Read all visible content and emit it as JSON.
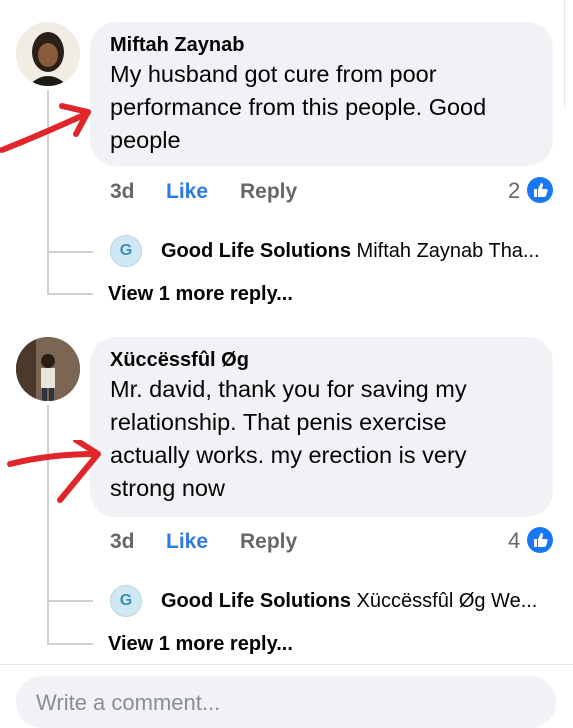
{
  "comments": [
    {
      "author": "Miftah Zaynab",
      "text_lines": [
        "My husband got cure from poor",
        "performance from this people. Good",
        "people"
      ],
      "time": "3d",
      "like_label": "Like",
      "reply_label": "Reply",
      "reaction_count": "2",
      "reply_preview": {
        "avatar_letter": "G",
        "name": "Good Life Solutions",
        "snippet": "Miftah Zaynab Tha..."
      },
      "more_replies": "View 1 more reply..."
    },
    {
      "author": "Xüccëssfûl Øg",
      "text_lines": [
        "Mr. david, thank you for saving my",
        "relationship. That penis exercise",
        "actually works. my erection is very",
        "strong now"
      ],
      "time": "3d",
      "like_label": "Like",
      "reply_label": "Reply",
      "reaction_count": "4",
      "reply_preview": {
        "avatar_letter": "G",
        "name": "Good Life Solutions",
        "snippet": "Xüccëssfûl Øg We..."
      },
      "more_replies": "View 1 more reply..."
    }
  ],
  "composer": {
    "placeholder": "Write a comment..."
  },
  "colors": {
    "like_blue": "#2d7ae5",
    "reaction_blue": "#1877f2",
    "arrow_red": "#e0262b",
    "bubble_bg": "#f0f2f5"
  }
}
